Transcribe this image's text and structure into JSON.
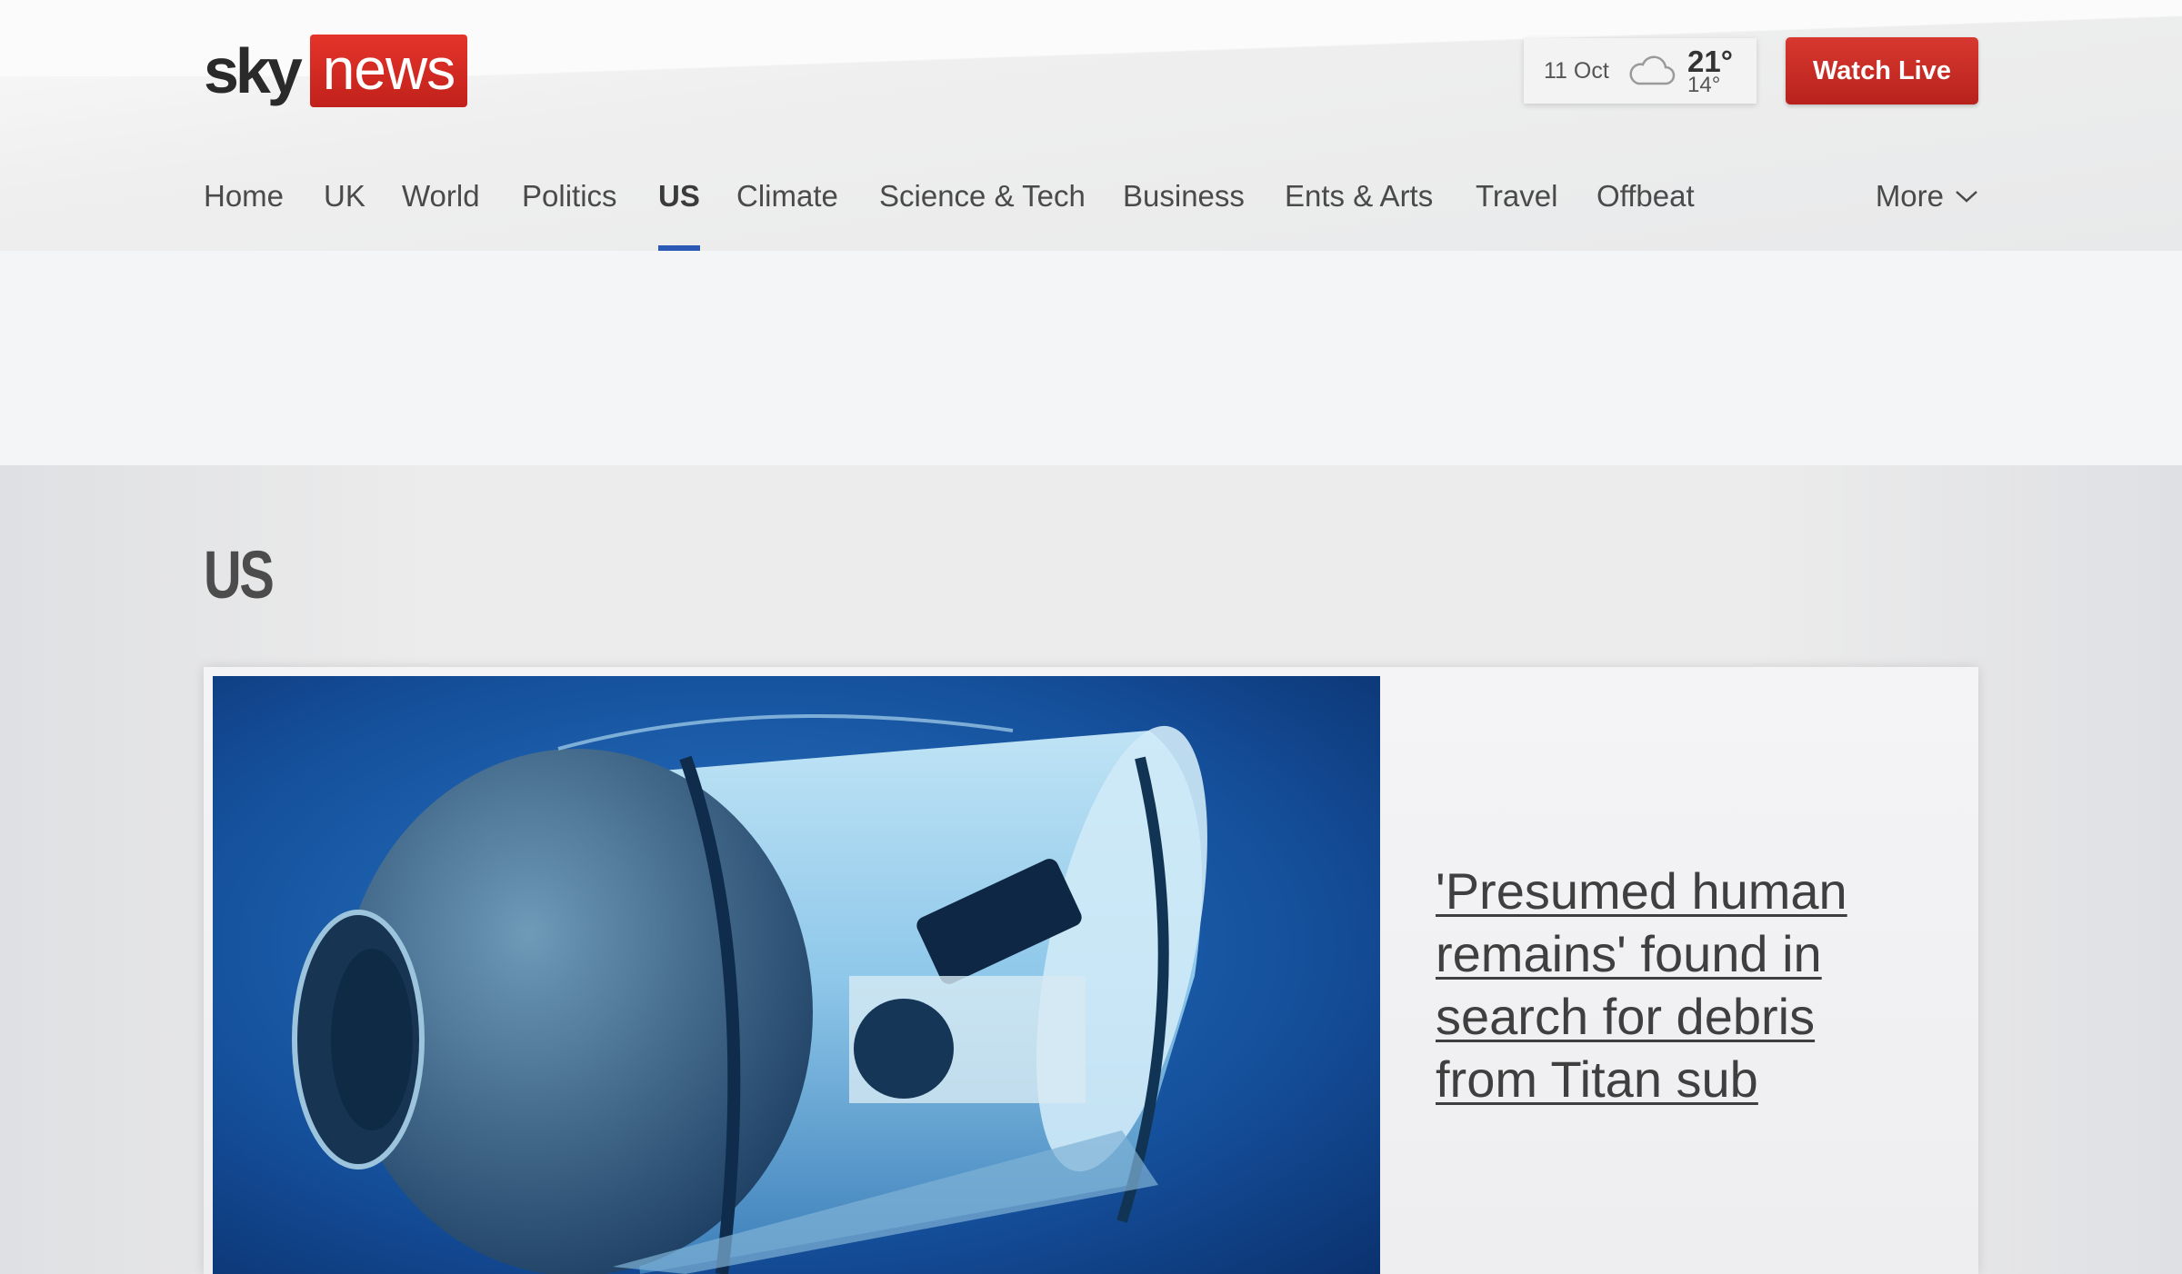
{
  "header": {
    "logo": {
      "sky": "sky",
      "news": "news"
    },
    "weather": {
      "date": "11 Oct",
      "icon": "cloud-icon",
      "high": "21°",
      "low": "14°"
    },
    "watch_live_label": "Watch Live"
  },
  "nav": {
    "items": [
      {
        "label": "Home"
      },
      {
        "label": "UK"
      },
      {
        "label": "World"
      },
      {
        "label": "Politics"
      },
      {
        "label": "US",
        "active": true
      },
      {
        "label": "Climate"
      },
      {
        "label": "Science & Tech"
      },
      {
        "label": "Business"
      },
      {
        "label": "Ents & Arts"
      },
      {
        "label": "Travel"
      },
      {
        "label": "Offbeat"
      }
    ],
    "more_label": "More"
  },
  "section": {
    "title": "US"
  },
  "lead_story": {
    "headline": "'Presumed human remains' found in search for debris from Titan sub",
    "image_subject": "submersible-photo"
  },
  "colors": {
    "brand_red": "#c8261f",
    "nav_active": "#2b59b6"
  }
}
